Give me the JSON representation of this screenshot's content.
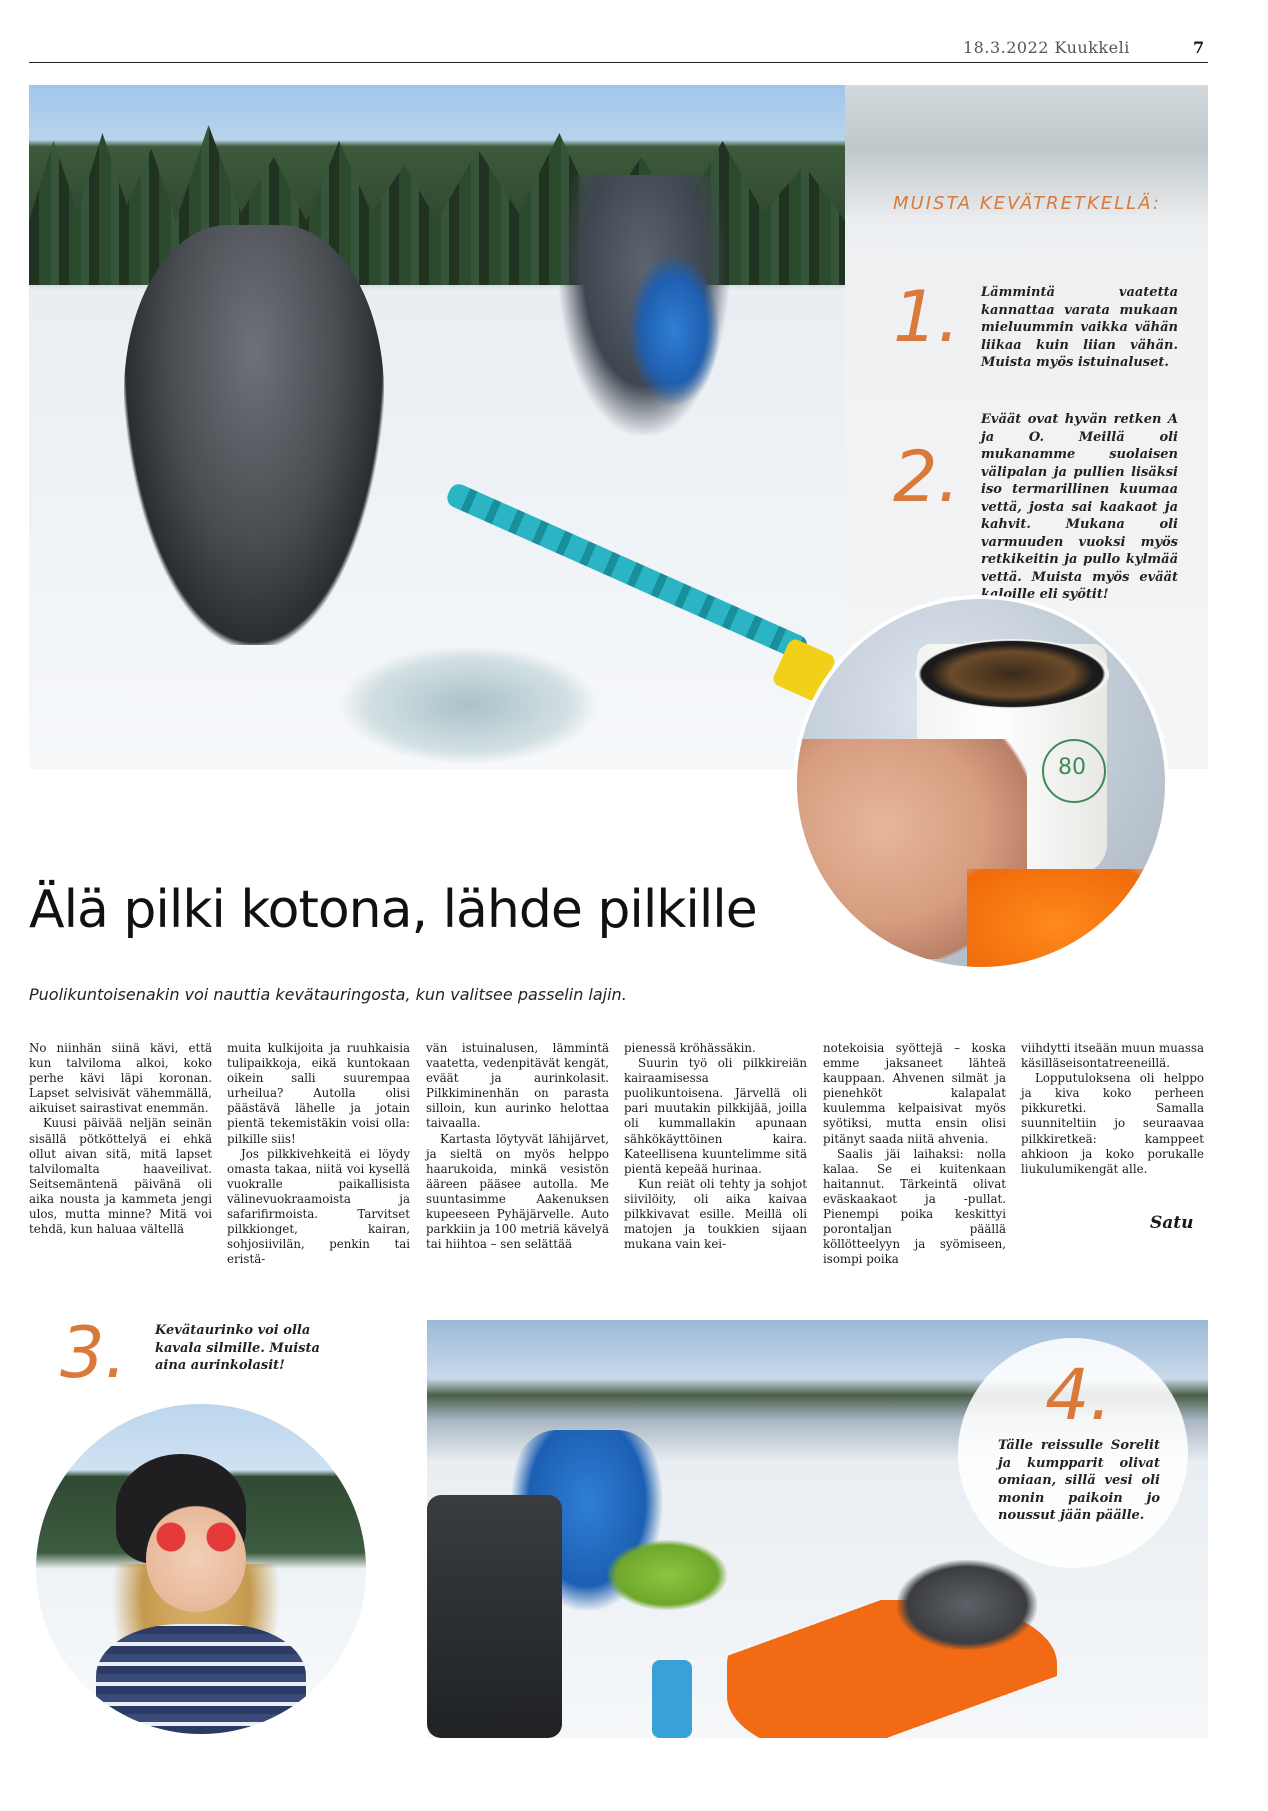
{
  "header": {
    "date_publication": "18.3.2022 Kuukkeli",
    "page_number": "7"
  },
  "sidebar": {
    "title": "MUISTA KEVÄTRETKELLÄ:",
    "tips": [
      {
        "number": "1.",
        "text": "Lämmintä vaatetta kannattaa varata mukaan mieluummin vaikka vähän liikaa kuin liian vähän. Muista myös istuinaluset."
      },
      {
        "number": "2.",
        "text": "Eväät ovat hyvän retken A ja O. Meillä oli mukanamme suolaisen välipalan ja pullien lisäksi iso termarillinen kuumaa vettä, josta sai kaakaot ja kahvit. Mukana oli varmuuden vuoksi myös retkikeitin ja pullo kylmää vettä. Muista myös eväät kaloille eli syötit!"
      }
    ]
  },
  "bottom_tips": [
    {
      "number": "3.",
      "text": "Kevätaurinko voi olla kavala silmille. Muista aina aurinkolasit!"
    },
    {
      "number": "4.",
      "text": "Tälle reissulle Sorelit ja kumpparit olivat omiaan, sillä vesi oli monin paikoin jo noussut jään päälle."
    }
  ],
  "photos": {
    "mug_text": "80"
  },
  "article": {
    "headline": "Älä pilki kotona, lähde pilkille",
    "lead": "Puolikuntoisenakin voi nauttia kevätauringosta, kun valitsee passelin lajin.",
    "columns": [
      [
        "No niinhän siinä kävi, että kun talviloma alkoi, koko perhe kävi läpi koronan. Lapset selvisivät vähemmällä, aikuiset sairastivat enemmän.",
        "Kuusi päivää neljän seinän sisällä pötköttelyä ei ehkä ollut aivan sitä, mitä lapset talvilomalta haaveilivat. Seitsemäntenä päivänä oli aika nousta ja kammeta jengi ulos, mutta minne? Mitä voi tehdä, kun haluaa vältellä"
      ],
      [
        "muita kulkijoita ja ruuhkaisia tulipaikkoja, eikä kuntokaan oikein salli suurempaa urheilua? Autolla olisi päästävä lähelle ja jotain pientä tekemistäkin voisi olla: pilkille siis!",
        "Jos pilkkivehkeitä ei löydy omasta takaa, niitä voi kysellä vuokralle paikallisista välinevuokraamoista ja safarifirmoista. Tarvitset pilkkionget, kairan, sohjosiivilän, penkin tai eristä-"
      ],
      [
        "vän istuinalusen, lämmintä vaatetta, vedenpitävät kengät, eväät ja aurinkolasit. Pilkkiminenhän on parasta silloin, kun aurinko helottaa taivaalla.",
        "Kartasta löytyvät lähijärvet, ja sieltä on myös helppo haarukoida, minkä vesistön ääreen pääsee autolla. Me suuntasimme Aakenuksen kupeeseen Pyhäjärvelle. Auto parkkiin ja 100 metriä kävelyä tai hiihtoa – sen selättää"
      ],
      [
        "pienessä kröhässäkin.",
        "Suurin työ oli pilkkireiän kairaamisessa puolikuntoisena. Järvellä oli pari muutakin pilkkijää, joilla oli kummallakin apunaan sähkökäyttöinen kaira. Kateellisena kuuntelimme sitä pientä kepeää hurinaa.",
        "Kun reiät oli tehty ja sohjot siivilöity, oli aika kaivaa pilkkivavat esille. Meillä oli matojen ja toukkien sijaan mukana vain kei-"
      ],
      [
        "notekoisia syöttejä – koska emme jaksaneet lähteä kauppaan. Ahvenen silmät ja pienehköt kalapalat kuulemma kelpaisivat myös syötiksi, mutta ensin olisi pitänyt saada niitä ahvenia.",
        "Saalis jäi laihaksi: nolla kalaa. Se ei kuitenkaan haitannut. Tärkeintä olivat eväskaakaot ja -pullat. Pienempi poika keskittyi porontaljan päällä köllötteelyyn ja syömiseen, isompi poika"
      ],
      [
        "viihdytti itseään muun muassa käsilläseisontatreeneillä.",
        "Lopputuloksena oli helppo ja kiva koko perheen pikkuretki. Samalla suunniteltiin jo seuraavaa pilkkiretkeä: kamppeet ahkioon ja koko porukalle liukulumikengät alle."
      ]
    ],
    "signature": "Satu"
  }
}
